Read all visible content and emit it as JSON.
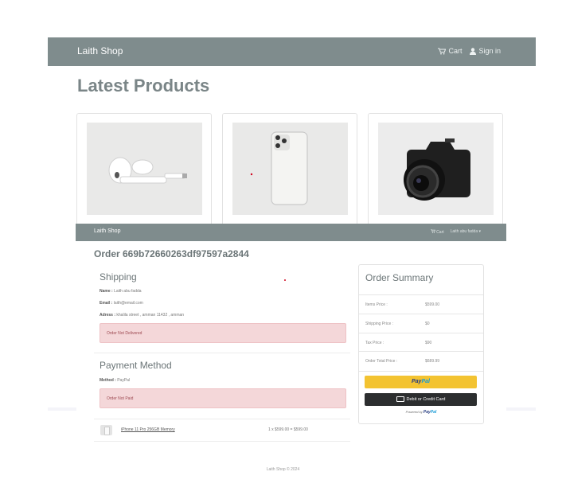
{
  "navbar": {
    "brand": "Laith Shop",
    "cart": "Cart",
    "signin": "Sign in"
  },
  "page_title": "Latest Products",
  "products": [
    {
      "name": "AirPods",
      "icon": "airpods-image"
    },
    {
      "name": "iPhone",
      "icon": "iphone-image"
    },
    {
      "name": "Camera",
      "icon": "camera-image"
    }
  ],
  "overlay_nav": {
    "brand": "Laith Shop",
    "cart": "Cart",
    "user": "Laith abu fadda ▾"
  },
  "order": {
    "title": "Order 669b72660263df97597a2844",
    "shipping": {
      "heading": "Shipping",
      "name_label": "Name :",
      "name_value": "Laith abu fadda",
      "email_label": "Email :",
      "email_value": "laith@email.com",
      "address_label": "Adress :",
      "address_value": "khalila street , amman 11432 , amman",
      "status": "Order Not Delivered"
    },
    "payment": {
      "heading": "Payment Method",
      "method_label": "Method :",
      "method_value": "PayPal",
      "status": "Order Not Paid"
    },
    "item": {
      "name": "iPhone 11 Pro 256GB Memory",
      "price": "1 x $599.00 = $599.00"
    }
  },
  "summary": {
    "title": "Order Summary",
    "rows": [
      {
        "label": "Items Price :",
        "value": "$599.00"
      },
      {
        "label": "Shipping Price :",
        "value": "$0"
      },
      {
        "label": "Tax Price :",
        "value": "$90"
      },
      {
        "label": "Order Total Price :",
        "value": "$689.99"
      }
    ],
    "paypal_pay": "Pay",
    "paypal_pal": "Pal",
    "card_button": "Debit or Credit Card",
    "powered_by": "Powered by",
    "powered_pay": "Pay",
    "powered_pal": "Pal"
  },
  "footer": "Laith Shop © 2024",
  "colors": {
    "navbar": "#7f8c8d",
    "alert_bg": "#f4d7d9",
    "paypal_yellow": "#f3c331",
    "paypal_blue": "#253b80",
    "card_button": "#2c2e2f"
  }
}
